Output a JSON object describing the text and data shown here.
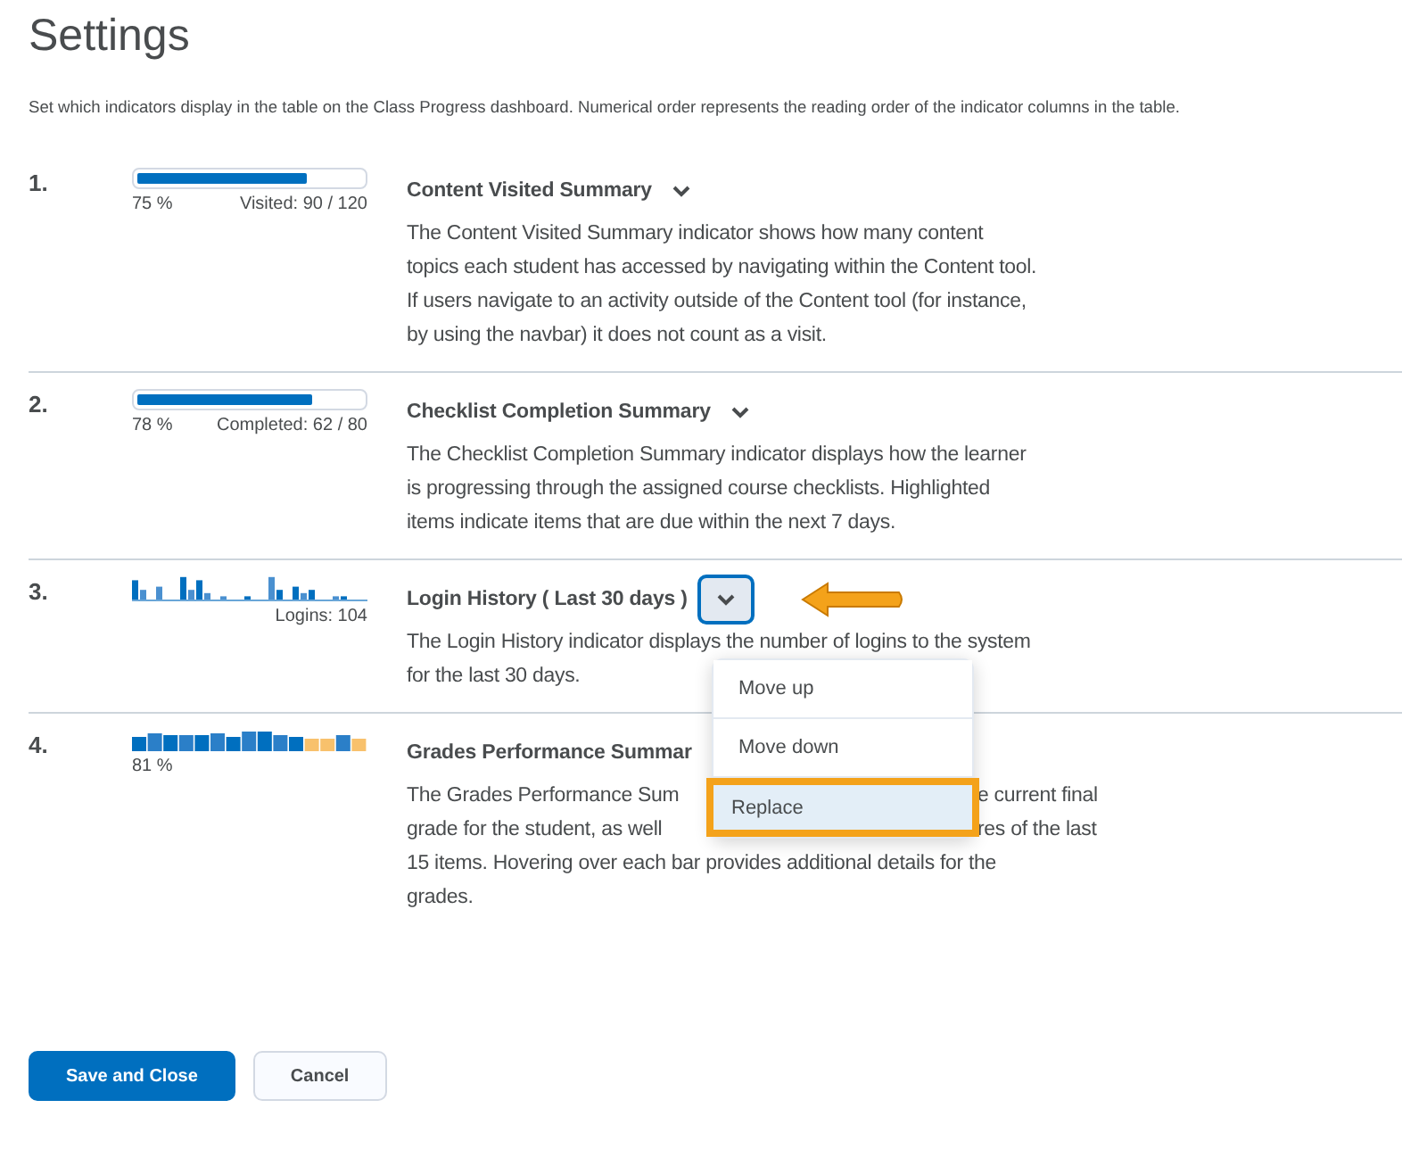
{
  "title": "Settings",
  "intro": "Set which indicators display in the table on the Class Progress dashboard. Numerical order represents the reading order of the indicator columns in the table.",
  "indicators": [
    {
      "number": "1.",
      "chart": {
        "kind": "progress",
        "level": 0.75,
        "percent": "75 %",
        "count": "Visited: 90 / 120"
      },
      "title": "Content Visited Summary",
      "expanded": false,
      "lines": [
        [
          "The Content Visited Summary indicator shows how many content"
        ],
        [
          "topics each student has accessed by navigating within the Content tool."
        ],
        [
          "If users navigate to an activity outside of the Content tool (for instance,"
        ],
        [
          "by using the navbar) it does not count as a visit."
        ]
      ]
    },
    {
      "number": "2.",
      "chart": {
        "kind": "progress",
        "level": 0.78,
        "percent": "78 %",
        "count": "Completed: 62 / 80"
      },
      "title": "Checklist Completion Summary",
      "expanded": false,
      "lines": [
        [
          "The Checklist Completion Summary indicator displays how the learner"
        ],
        [
          "is progressing through the assigned course checklists. Highlighted"
        ],
        [
          "items indicate items that are due within the next 7 days."
        ]
      ]
    },
    {
      "number": "3.",
      "chart": {
        "kind": "logins",
        "count": "Logins: 104"
      },
      "title": "Login History ( Last 30 days )",
      "expanded": true,
      "lines": [
        [
          "The Login History indicator displays the number of logins to the system"
        ],
        [
          "for the last 30 days."
        ]
      ],
      "menu": [
        {
          "label": "Move up",
          "selected": false
        },
        {
          "label": "Move down",
          "selected": false
        },
        {
          "label": "Replace",
          "selected": true
        }
      ]
    },
    {
      "number": "4.",
      "chart": {
        "kind": "grades",
        "percent": "81 %"
      },
      "title": "Grades Performance Summar",
      "lines": [
        [
          "The Grades Performance Sum",
          "e current final"
        ],
        [
          "grade for the student, as well",
          "res of the last"
        ],
        [
          "15 items. Hovering over each bar provides additional details for the"
        ],
        [
          "grades."
        ]
      ]
    }
  ],
  "buttons": [
    {
      "label": "Save and Close",
      "kind": "primary"
    },
    {
      "label": "Cancel",
      "kind": "secondary"
    }
  ]
}
